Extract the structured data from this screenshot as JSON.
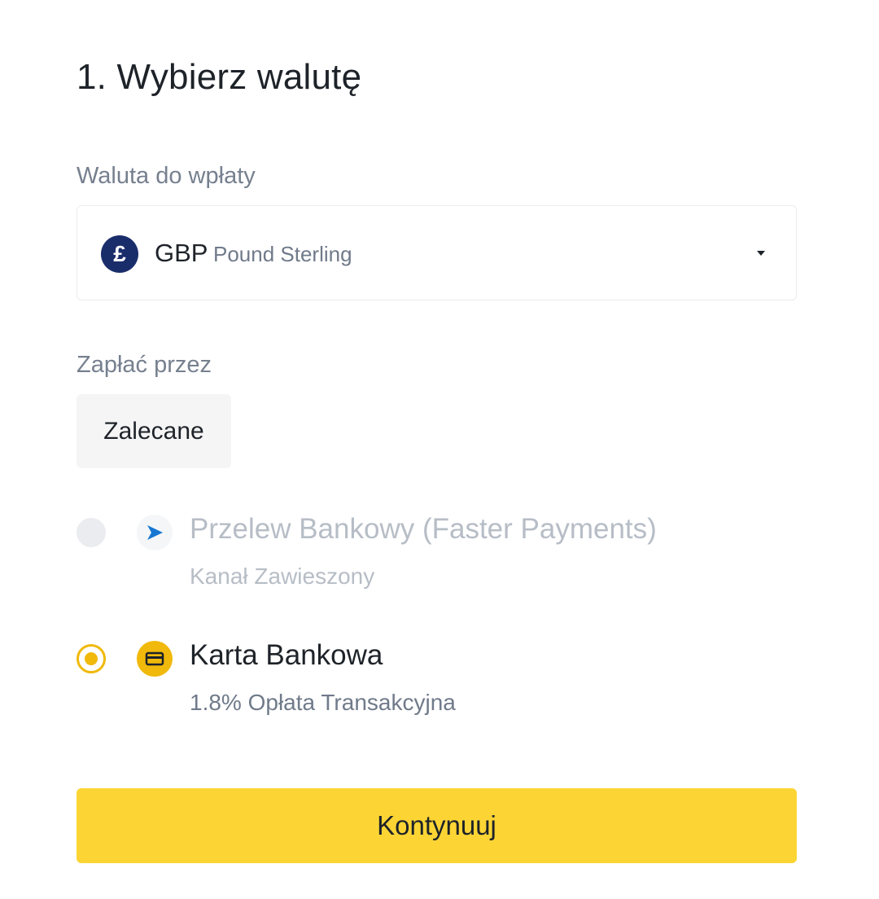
{
  "step": {
    "title": "1. Wybierz walutę"
  },
  "currency": {
    "label": "Waluta do wpłaty",
    "icon": "pound-sterling-icon",
    "icon_glyph": "£",
    "code": "GBP",
    "name": "Pound Sterling"
  },
  "payment": {
    "label": "Zapłać przez",
    "tab": "Zalecane",
    "options": [
      {
        "icon": "bank-transfer-arrow-icon",
        "title": "Przelew Bankowy (Faster Payments)",
        "subtitle": "Kanał Zawieszony",
        "state": "disabled"
      },
      {
        "icon": "bank-card-icon",
        "title": "Karta Bankowa",
        "subtitle": "1.8% Opłata Transakcyjna",
        "state": "selected"
      }
    ]
  },
  "actions": {
    "continue_label": "Kontynuuj"
  },
  "colors": {
    "accent": "#f0b90b",
    "button": "#fcd535",
    "pound_icon": "#1a2d6b",
    "transfer_arrow": "#1677d2"
  }
}
